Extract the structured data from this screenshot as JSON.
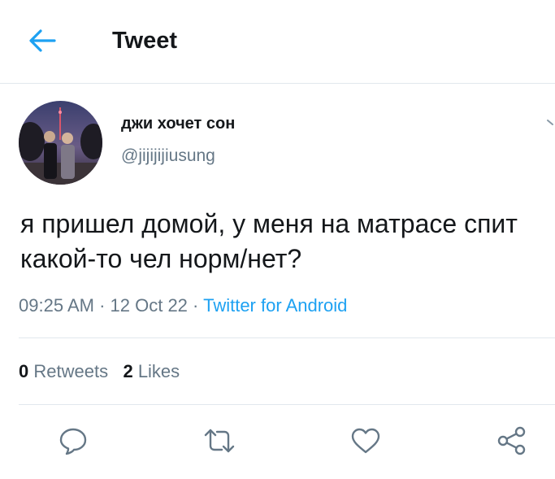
{
  "header": {
    "title": "Tweet",
    "back_icon": "arrow-left-icon"
  },
  "tweet": {
    "author": {
      "display_name": "джи хочет сон",
      "handle": "@jijijijiusung"
    },
    "text": "я пришел домой, у меня на матрасе спит какой-то чел норм/нет?",
    "time": "09:25 AM",
    "date": "12 Oct 22",
    "separator": "·",
    "source": "Twitter for Android",
    "stats": {
      "retweets_count": "0",
      "retweets_label": "Retweets",
      "likes_count": "2",
      "likes_label": "Likes"
    },
    "actions": [
      "reply-icon",
      "retweet-icon",
      "like-icon",
      "share-icon"
    ]
  },
  "colors": {
    "accent": "#1da1f2",
    "text_primary": "#14171a",
    "text_secondary": "#657786",
    "divider": "#e1e8ed"
  }
}
